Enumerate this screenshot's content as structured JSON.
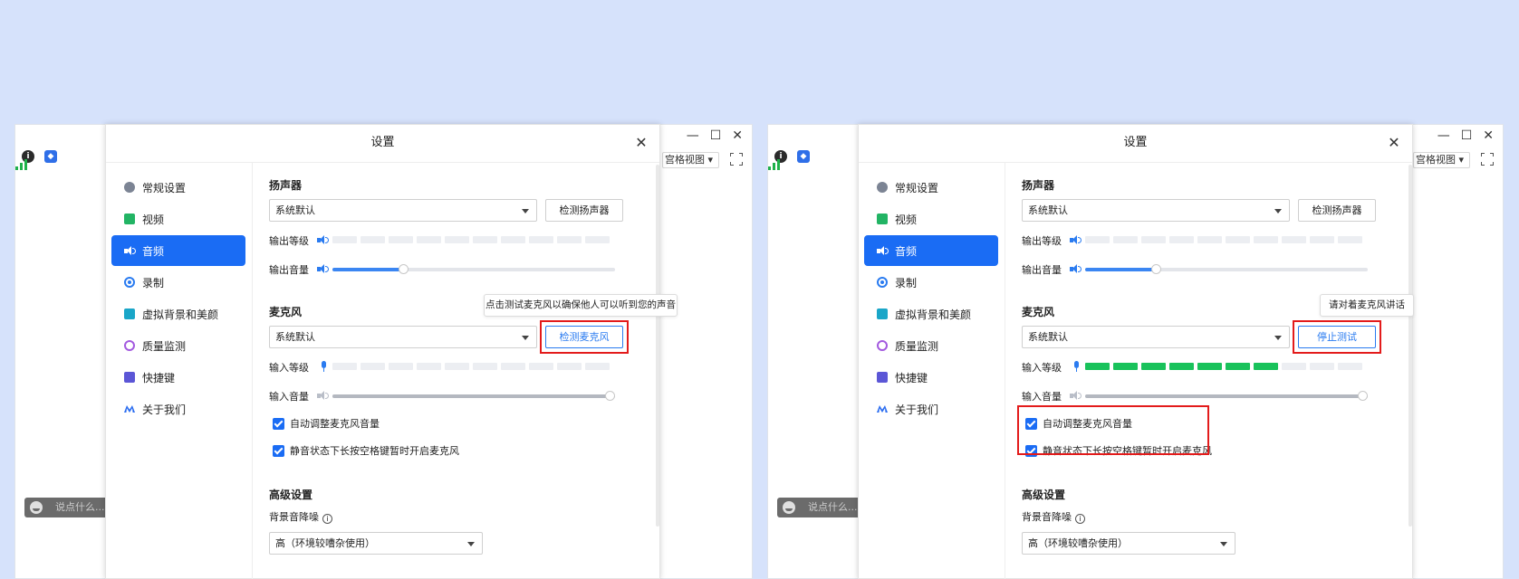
{
  "panels": [
    {
      "id": "left",
      "app": {
        "grid_view_label": "宫格视图",
        "chat_placeholder": "说点什么..."
      },
      "dialog": {
        "title": "设置",
        "nav": [
          "常规设置",
          "视频",
          "音频",
          "录制",
          "虚拟背景和美颜",
          "质量监测",
          "快捷键",
          "关于我们"
        ],
        "active_nav": "音频",
        "speaker": {
          "section_title": "扬声器",
          "device": "系统默认",
          "test_button": "检测扬声器",
          "output_level_label": "输出等级",
          "output_level_segments_on": 0,
          "output_level_segments_total": 10,
          "output_volume_label": "输出音量",
          "output_volume_percent": 25
        },
        "mic": {
          "section_title": "麦克风",
          "device": "系统默认",
          "test_button": "检测麦克风",
          "tooltip": "点击测试麦克风以确保他人可以听到您的声音",
          "input_level_label": "输入等级",
          "input_level_segments_on": 0,
          "input_level_segments_total": 10,
          "input_volume_label": "输入音量",
          "input_volume_percent": 100,
          "auto_adjust_label": "自动调整麦克风音量",
          "auto_adjust_checked": true,
          "hold_space_label": "静音状态下长按空格键暂时开启麦克风",
          "hold_space_checked": true
        },
        "advanced": {
          "section_title": "高级设置",
          "noise_label": "背景音降噪",
          "noise_value": "高（环境较嘈杂使用）"
        }
      }
    },
    {
      "id": "right",
      "app": {
        "grid_view_label": "宫格视图",
        "chat_placeholder": "说点什么..."
      },
      "dialog": {
        "title": "设置",
        "nav": [
          "常规设置",
          "视频",
          "音频",
          "录制",
          "虚拟背景和美颜",
          "质量监测",
          "快捷键",
          "关于我们"
        ],
        "active_nav": "音频",
        "speaker": {
          "section_title": "扬声器",
          "device": "系统默认",
          "test_button": "检测扬声器",
          "output_level_label": "输出等级",
          "output_level_segments_on": 0,
          "output_level_segments_total": 10,
          "output_volume_label": "输出音量",
          "output_volume_percent": 25
        },
        "mic": {
          "section_title": "麦克风",
          "device": "系统默认",
          "test_button": "停止测试",
          "tooltip": "请对着麦克风讲话",
          "input_level_label": "输入等级",
          "input_level_segments_on": 7,
          "input_level_segments_total": 10,
          "input_volume_label": "输入音量",
          "input_volume_percent": 100,
          "auto_adjust_label": "自动调整麦克风音量",
          "auto_adjust_checked": true,
          "hold_space_label": "静音状态下长按空格键暂时开启麦克风",
          "hold_space_checked": true
        },
        "advanced": {
          "section_title": "高级设置",
          "noise_label": "背景音降噪",
          "noise_value": "高（环境较嘈杂使用）"
        }
      }
    }
  ],
  "colors": {
    "page_bg": "#d6e2fb",
    "accent": "#1a6cf4",
    "level_on": "#19c25b",
    "highlight": "#e31b1b"
  }
}
